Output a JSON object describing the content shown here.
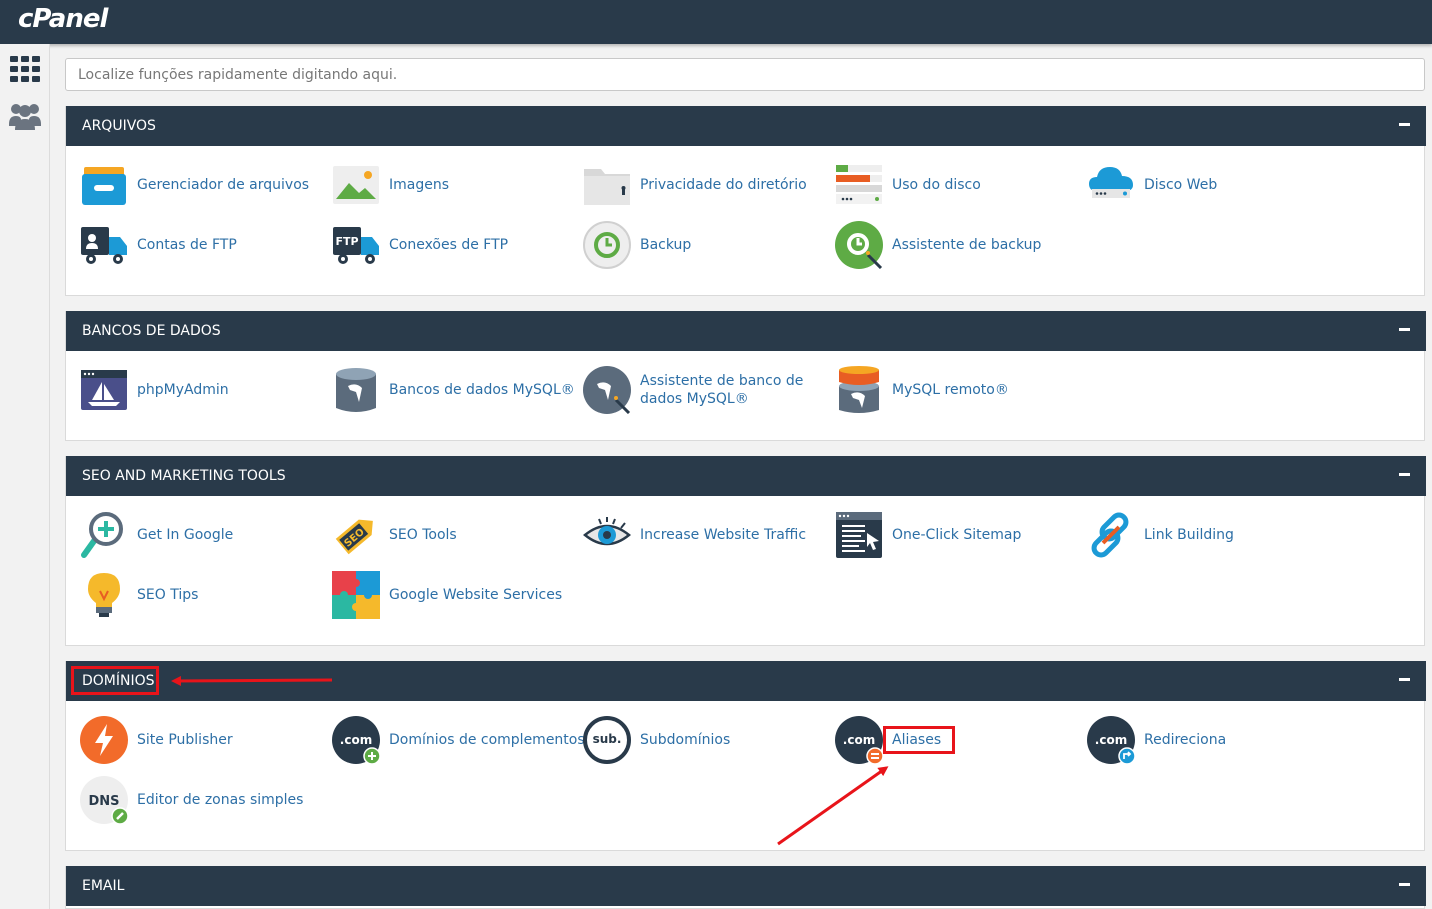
{
  "app": {
    "logo": "cPanel"
  },
  "search": {
    "placeholder": "Localize funções rapidamente digitando aqui."
  },
  "sidebar": {
    "items": [
      {
        "icon": "apps-grid-icon"
      },
      {
        "icon": "users-icon"
      }
    ]
  },
  "sections": {
    "arquivos": {
      "title": "ARQUIVOS",
      "items": [
        "Gerenciador de arquivos",
        "Imagens",
        "Privacidade do diretório",
        "Uso do disco",
        "Disco Web",
        "Contas de FTP",
        "Conexões de FTP",
        "Backup",
        "Assistente de backup"
      ]
    },
    "bancos": {
      "title": "BANCOS DE DADOS",
      "items": [
        "phpMyAdmin",
        "Bancos de dados MySQL®",
        "Assistente de banco de dados MySQL®",
        "MySQL remoto®"
      ]
    },
    "seo": {
      "title": "SEO AND MARKETING TOOLS",
      "items": [
        "Get In Google",
        "SEO Tools",
        "Increase Website Traffic",
        "One-Click Sitemap",
        "Link Building",
        "SEO Tips",
        "Google Website Services"
      ]
    },
    "dominios": {
      "title": "DOMÍNIOS",
      "items": [
        "Site Publisher",
        "Domínios de complementos",
        "Subdomínios",
        "Aliases",
        "Redireciona",
        "Editor de zonas simples"
      ]
    },
    "email": {
      "title": "EMAIL"
    }
  },
  "icons": {
    "dotcom": ".com",
    "sub": "sub.",
    "dns": "DNS",
    "ftp": "FTP",
    "seo": "SEO"
  },
  "colors": {
    "header": "#293a4a",
    "link": "#2d6fa6",
    "highlight": "#e8141a"
  }
}
